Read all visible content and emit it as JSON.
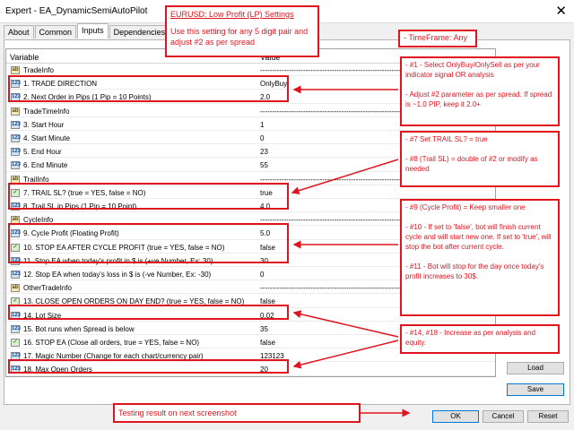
{
  "window": {
    "title": "Expert - EA_DynamicSemiAutoPilot",
    "close_glyph": "✕"
  },
  "tabs": [
    "About",
    "Common",
    "Inputs",
    "Dependencies"
  ],
  "grid": {
    "col_variable": "Variable",
    "col_value": "Value",
    "rows": [
      {
        "icon": "ab",
        "var": "TradeInfo",
        "val": "-----------------------------------------------------------Enter TRADE Info----------------------------------------------------"
      },
      {
        "icon": "n",
        "var": "1. TRADE DIRECTION",
        "val": "OnlyBuy"
      },
      {
        "icon": "n",
        "var": "2. Next Order in Pips (1 Pip = 10 Points)",
        "val": "2.0"
      },
      {
        "icon": "ab",
        "var": "TradeTimeInfo",
        "val": "-----------------------------------------------------------Enter TRADE TIME Info----------------------------------------------"
      },
      {
        "icon": "n",
        "var": "3. Start Hour",
        "val": "1"
      },
      {
        "icon": "n",
        "var": "4. Start Minute",
        "val": "0"
      },
      {
        "icon": "n",
        "var": "5. End Hour",
        "val": "23"
      },
      {
        "icon": "n",
        "var": "6. End Minute",
        "val": "55"
      },
      {
        "icon": "ab",
        "var": "TrailInfo",
        "val": "-----------------------------------------------------------Enter TRAILING STOPLOSS Info----------------------------------------"
      },
      {
        "icon": "b",
        "var": "7. TRAIL SL? (true = YES, false = NO)",
        "val": "true"
      },
      {
        "icon": "n",
        "var": "8. Trail SL in Pips (1 Pip = 10 Point)",
        "val": "4.0"
      },
      {
        "icon": "ab",
        "var": "CycleInfo",
        "val": "-----------------------------------------------------------Enter CYCLE Info-------------------------------------------------------"
      },
      {
        "icon": "n",
        "var": "9. Cycle Profit (Floating Profit)",
        "val": "5.0"
      },
      {
        "icon": "b",
        "var": "10. STOP EA AFTER CYCLE PROFIT (true = YES, false = NO)",
        "val": "false"
      },
      {
        "icon": "n",
        "var": "11. Stop EA when today's profit in $ is (+ve Number, Ex: 30)",
        "val": "30"
      },
      {
        "icon": "n",
        "var": "12. Stop EA when today's loss in $ is (-ve Number, Ex: -30)",
        "val": "0"
      },
      {
        "icon": "ab",
        "var": "OtherTradeInfo",
        "val": "-----------------------------------------------------------Enter OTHER TRADE Info------------------------------------------------"
      },
      {
        "icon": "b",
        "var": "13. CLOSE OPEN ORDERS ON DAY END? (true = YES, false = NO)",
        "val": "false"
      },
      {
        "icon": "n",
        "var": "14. Lot Size",
        "val": "0.02"
      },
      {
        "icon": "n",
        "var": "15. Bot runs when Spread is below",
        "val": "35"
      },
      {
        "icon": "b",
        "var": "16. STOP EA (Close all orders, true = YES, false = NO)",
        "val": "false"
      },
      {
        "icon": "n",
        "var": "17. Magic Number (Change for each chart/currency pair)",
        "val": "123123"
      },
      {
        "icon": "n",
        "var": "18. Max Open Orders",
        "val": "20"
      }
    ]
  },
  "buttons": {
    "load": "Load",
    "save": "Save",
    "ok": "OK",
    "cancel": "Cancel",
    "reset": "Reset"
  },
  "callouts": {
    "settings_title": "EURUSD: Low Profit (LP) Settings",
    "settings_body": "Use this setting for any 5 digit pair and adjust #2 as per spread",
    "timeframe": "- TimeFrame: Any",
    "note_1_2": "- #1 - Select OnlyBuy/OnlySell as per your indicator signal OR analysis\n\n- Adjust #2 parameter as per spread. If spread is ~1.0 PIP, keep it 2.0+",
    "note_7_8": "- #7 Set TRAIL SL? = true\n\n- #8 (Trail SL) = double of #2 or modify as needed",
    "note_9_11": "- #9 (Cycle Profit) = Keep smaller one\n\n- #10 - If set to 'false', bot will finish current cycle and will start new one. If set to 'true', will stop the bot after current cycle.\n\n- #11 - Bot will stop for the day once today's profit increases to 30$.",
    "note_14_18": "- #14, #18 - Increase as per analysis and equity.",
    "testing": "Testing result on next screenshot"
  }
}
